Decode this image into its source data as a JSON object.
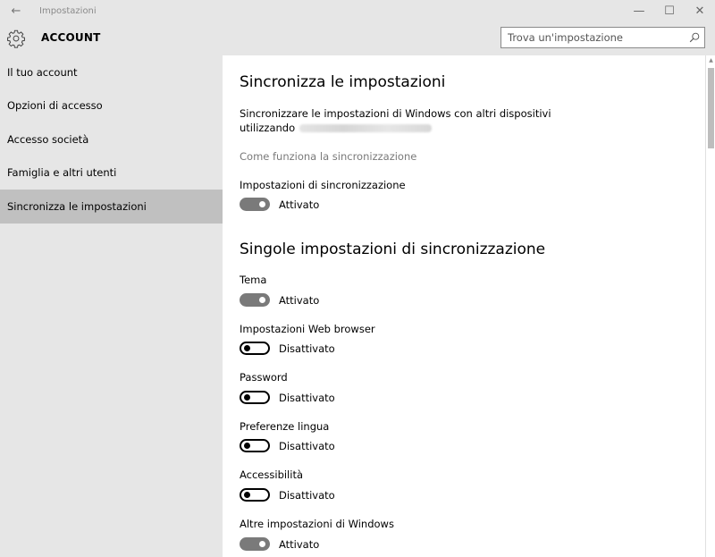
{
  "window": {
    "title": "Impostazioni",
    "back_icon": "←",
    "minimize": "—",
    "maximize": "☐",
    "close": "✕"
  },
  "header": {
    "title": "ACCOUNT",
    "search_placeholder": "Trova un'impostazione"
  },
  "sidebar": {
    "items": [
      {
        "label": "Il tuo account"
      },
      {
        "label": "Opzioni di accesso"
      },
      {
        "label": "Accesso società"
      },
      {
        "label": "Famiglia e altri utenti"
      },
      {
        "label": "Sincronizza le impostazioni"
      }
    ],
    "active_index": 4
  },
  "main": {
    "title": "Sincronizza le impostazioni",
    "description": "Sincronizzare le impostazioni di Windows con altri dispositivi utilizzando",
    "link": "Come funziona la sincronizzazione",
    "sync_setting": {
      "label": "Impostazioni di sincronizzazione",
      "state": "Attivato",
      "on": true
    },
    "section_title": "Singole impostazioni di sincronizzazione",
    "settings": [
      {
        "label": "Tema",
        "state": "Attivato",
        "on": true
      },
      {
        "label": "Impostazioni Web browser",
        "state": "Disattivato",
        "on": false
      },
      {
        "label": "Password",
        "state": "Disattivato",
        "on": false
      },
      {
        "label": "Preferenze lingua",
        "state": "Disattivato",
        "on": false
      },
      {
        "label": "Accessibilità",
        "state": "Disattivato",
        "on": false
      },
      {
        "label": "Altre impostazioni di Windows",
        "state": "Attivato",
        "on": true
      }
    ]
  },
  "colors": {
    "background": "#e6e6e6",
    "content": "#ffffff",
    "active_nav": "#c0c0c0",
    "toggle_on": "#7a7a7a"
  }
}
